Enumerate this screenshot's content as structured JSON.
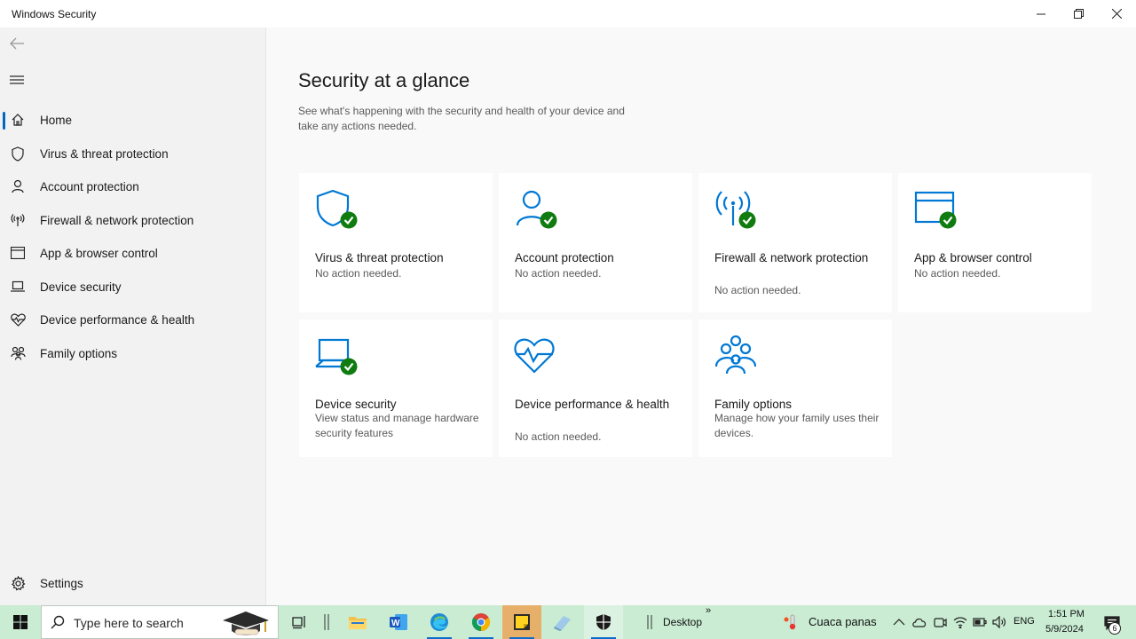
{
  "window": {
    "title": "Windows Security"
  },
  "sidebar": {
    "items": [
      {
        "label": "Home",
        "icon": "home-icon"
      },
      {
        "label": "Virus & threat protection",
        "icon": "shield-icon"
      },
      {
        "label": "Account protection",
        "icon": "person-icon"
      },
      {
        "label": "Firewall & network protection",
        "icon": "antenna-icon"
      },
      {
        "label": "App & browser control",
        "icon": "browser-window-icon"
      },
      {
        "label": "Device security",
        "icon": "laptop-icon"
      },
      {
        "label": "Device performance & health",
        "icon": "heart-pulse-icon"
      },
      {
        "label": "Family options",
        "icon": "family-icon"
      }
    ],
    "settings_label": "Settings"
  },
  "main": {
    "title": "Security at a glance",
    "subtitle": "See what's happening with the security and health of your device and take any actions needed.",
    "tiles": [
      {
        "name": "Virus & threat protection",
        "status": "No action needed."
      },
      {
        "name": "Account protection",
        "status": "No action needed."
      },
      {
        "name": "Firewall & network protection",
        "status": "No action needed."
      },
      {
        "name": "App & browser control",
        "status": "No action needed."
      },
      {
        "name": "Device security",
        "status": "View status and manage hardware security features"
      },
      {
        "name": "Device performance & health",
        "status": "No action needed."
      },
      {
        "name": "Family options",
        "status": "Manage how your family uses their devices."
      }
    ]
  },
  "taskbar": {
    "search_placeholder": "Type here to search",
    "desktop_label": "Desktop",
    "weather_text": "Cuaca panas",
    "language": "ENG",
    "time": "1:51 PM",
    "date": "5/9/2024",
    "notification_count": "6"
  },
  "colors": {
    "accent": "#0067c0",
    "icon_blue": "#0078d4",
    "check_green": "#107c10",
    "taskbar_bg": "#c9ecd3"
  }
}
